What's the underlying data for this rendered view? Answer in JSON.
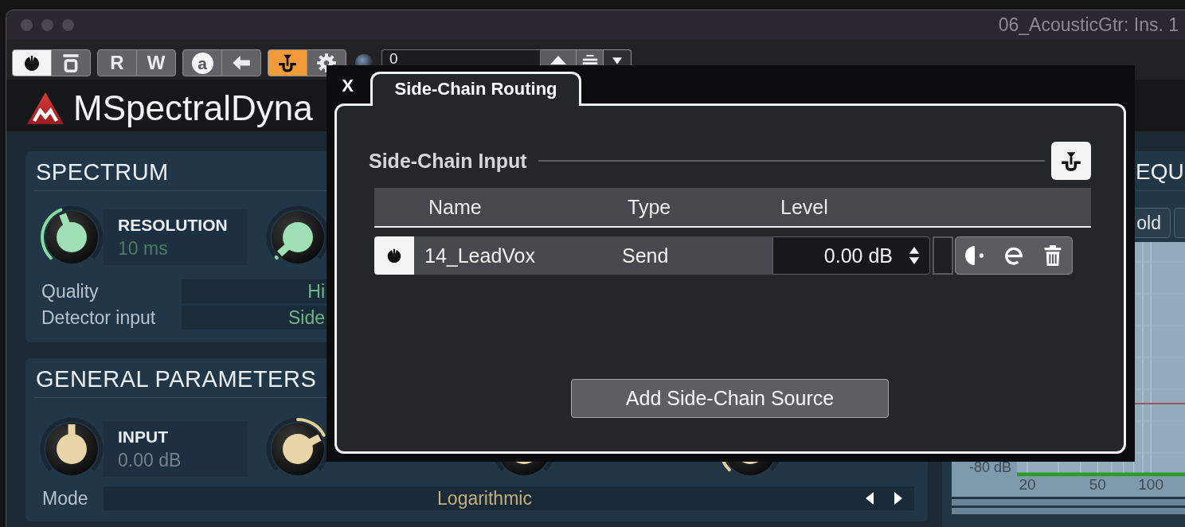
{
  "window": {
    "title": "06_AcousticGtr: Ins. 1"
  },
  "toolbar": {
    "groups": [
      [
        {
          "kind": "power",
          "on": true
        },
        {
          "kind": "bypass",
          "on": false
        }
      ],
      [
        {
          "kind": "text",
          "label": "R",
          "on": false
        },
        {
          "kind": "text",
          "label": "W",
          "on": false
        }
      ],
      [
        {
          "kind": "letter",
          "label": "a",
          "on": false
        },
        {
          "kind": "arrow",
          "on": false
        }
      ],
      [
        {
          "kind": "sidechain",
          "on": true
        },
        {
          "kind": "gear",
          "on": false
        }
      ]
    ],
    "preset": {
      "value": "0"
    }
  },
  "plugin": {
    "title": "MSpectralDyna",
    "spectrum": {
      "title": "SPECTRUM",
      "knobs": [
        {
          "kind": "unipolar",
          "label": "RESOLUTION",
          "value": "10 ms",
          "level": 0.42
        },
        {
          "kind": "unipolar",
          "level": 0.01
        }
      ],
      "rows": [
        {
          "label": "Quality",
          "value": "Hi"
        },
        {
          "label": "Detector input",
          "value": "Side"
        }
      ]
    },
    "general": {
      "title": "GENERAL PARAMETERS",
      "knobs": [
        {
          "kind": "bipolar",
          "label": "INPUT",
          "value": "0.00 dB",
          "level": 0.5
        },
        {
          "kind": "bipolar",
          "level": 0.73
        },
        {
          "kind": "bipolar"
        },
        {
          "kind": "unipolar",
          "level": 0.17
        }
      ],
      "mode": {
        "label": "Mode",
        "value": "Logarithmic"
      }
    },
    "equalizer": {
      "title": "EQU",
      "button": "old",
      "graph": {
        "y_label": "-80 dB",
        "x_labels": [
          "20",
          "50",
          "100"
        ]
      }
    }
  },
  "dialog": {
    "close": "X",
    "tabs": [
      {
        "label": "Side-Chain Routing",
        "selected": true
      }
    ],
    "section": "Side-Chain Input",
    "columns": [
      "Name",
      "Type",
      "Level"
    ],
    "rows": [
      {
        "on": true,
        "name": "14_LeadVox",
        "type": "Send",
        "level": "0.00 dB"
      }
    ],
    "add_button": "Add Side-Chain Source"
  }
}
